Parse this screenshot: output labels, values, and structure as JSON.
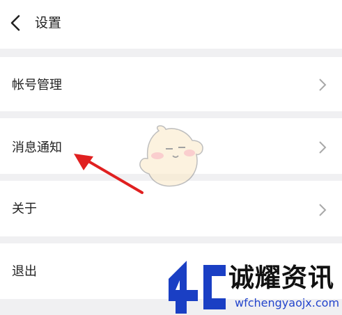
{
  "header": {
    "title": "设置",
    "back_icon": "chevron-left-icon"
  },
  "menu": [
    {
      "label": "帐号管理",
      "icon": "chevron-right-icon"
    },
    {
      "label": "消息通知",
      "icon": "chevron-right-icon"
    },
    {
      "label": "关于",
      "icon": "chevron-right-icon"
    },
    {
      "label": "退出"
    }
  ],
  "annotation": {
    "arrow_color": "#e02020",
    "icon": "red-arrow"
  },
  "watermark": {
    "name": "诚耀资讯",
    "url": "wfchengyaojx.com",
    "brand_color": "#1a3fc4"
  },
  "colors": {
    "background": "#f0f0f2",
    "surface": "#ffffff",
    "chevron": "#a8a8a8",
    "text": "#222222"
  }
}
